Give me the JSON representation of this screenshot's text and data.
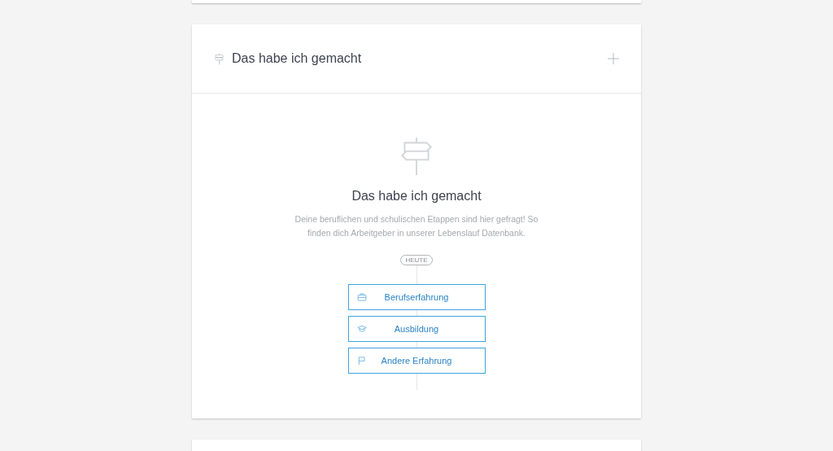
{
  "section": {
    "title": "Das habe ich gemacht"
  },
  "empty_state": {
    "title": "Das habe ich gemacht",
    "description": "Deine beruflichen und schulischen Etappen sind hier gefragt! So finden dich Arbeitgeber in unserer Lebenslauf Datenbank.",
    "timeline_badge": "HEUTE"
  },
  "buttons": [
    {
      "label": "Berufserfahrung",
      "kind": "work"
    },
    {
      "label": "Ausbildung",
      "kind": "education"
    },
    {
      "label": "Andere Erfahrung",
      "kind": "other"
    }
  ]
}
